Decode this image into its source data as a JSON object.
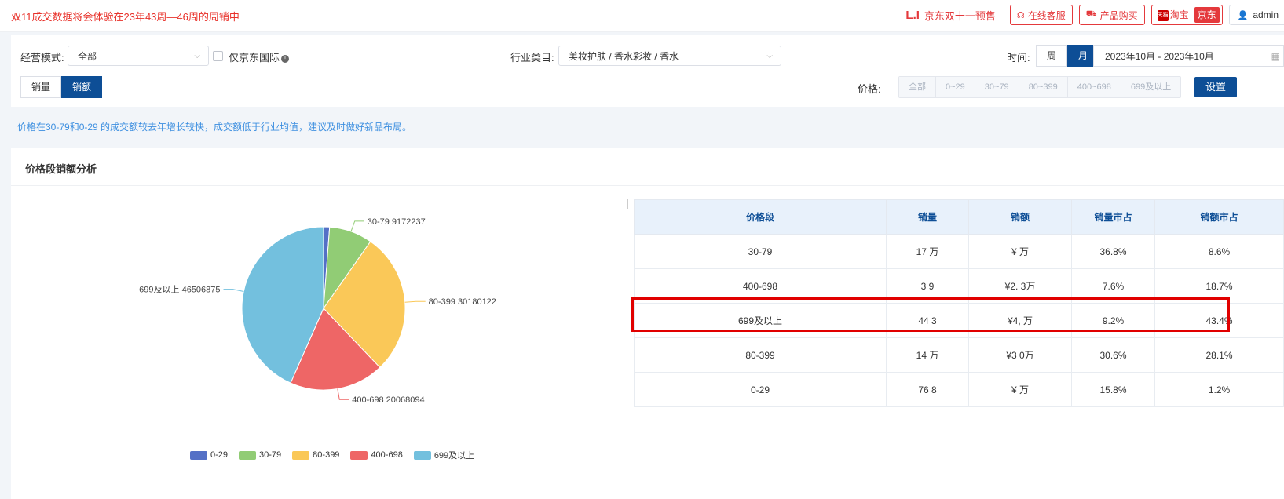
{
  "topbar": {
    "notice": "双11成交数据将会体验在23年43周—46周的周销中",
    "presale_logo": "L.I",
    "presale_label": "京东双十一预售",
    "service_label": "在线客服",
    "buy_label": "产品购买",
    "shop_tmall_mini": "天猫",
    "shop_taobao": "淘宝",
    "shop_jd": "京东",
    "user": "admin"
  },
  "filters": {
    "mode_label": "经营模式:",
    "mode_value": "全部",
    "jd_intl_label": "仅京东国际",
    "industry_label": "行业类目:",
    "industry_value": "美妆护肤 / 香水彩妆 / 香水",
    "time_label": "时间:",
    "time_tabs": [
      "周",
      "月"
    ],
    "time_active": "月",
    "date_range": "2023年10月 - 2023年10月",
    "metric_tabs": [
      "销量",
      "销额"
    ],
    "metric_active": "销额",
    "price_label": "价格:",
    "price_ranges": [
      "全部",
      "0~29",
      "30~79",
      "80~399",
      "400~698",
      "699及以上"
    ],
    "set_label": "设置"
  },
  "tip": "价格在30-79和0-29 的成交额较去年增长较快，成交额低于行业均值，建议及时做好新品布局。",
  "card": {
    "title": "价格段销额分析"
  },
  "chart_data": {
    "type": "pie",
    "categories": [
      "0-29",
      "30-79",
      "80-399",
      "400-698",
      "699及以上"
    ],
    "values": [
      1270000,
      9172237,
      30180122,
      20068094,
      46506875
    ],
    "labels": {
      "30-79": "30-79   9172237",
      "80-399": "80-399   30180122",
      "400-698": "400-698   20068094",
      "699及以上": "699及以上   46506875"
    },
    "colors": [
      "#5470c6",
      "#91cc75",
      "#fac858",
      "#ee6666",
      "#73c0de"
    ],
    "legend": "bottom"
  },
  "table": {
    "headers": [
      "价格段",
      "销量",
      "销额",
      "销量市占",
      "销额市占"
    ],
    "rows": [
      [
        "30-79",
        "17 万",
        "¥ 万",
        "36.8%",
        "8.6%"
      ],
      [
        "400-698",
        "3 9",
        "¥2. 3万",
        "7.6%",
        "18.7%"
      ],
      [
        "699及以上",
        "44 3",
        "¥4, 万",
        "9.2%",
        "43.4%"
      ],
      [
        "80-399",
        "14 万",
        "¥3 0万",
        "30.6%",
        "28.1%"
      ],
      [
        "0-29",
        "76 8",
        "¥ 万",
        "15.8%",
        "1.2%"
      ]
    ]
  }
}
